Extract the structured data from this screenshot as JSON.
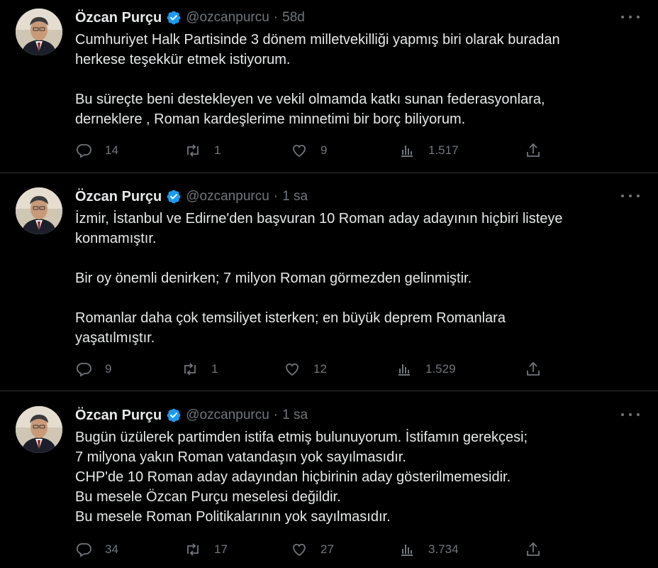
{
  "tweets": [
    {
      "author": {
        "name": "Özcan Purçu",
        "handle": "@ozcanpurcu"
      },
      "time": "58d",
      "paragraphs": [
        [
          "Cumhuriyet Halk Partisinde 3 dönem milletvekilliği yapmış biri olarak buradan",
          "herkese teşekkür etmek istiyorum."
        ],
        [
          "Bu süreçte beni destekleyen ve vekil olmamda katkı sunan federasyonlara,",
          "derneklere , Roman kardeşlerime minnetimi bir borç biliyorum."
        ]
      ],
      "stats": {
        "replies": "14",
        "retweets": "1",
        "likes": "9",
        "views": "1.517"
      }
    },
    {
      "author": {
        "name": "Özcan Purçu",
        "handle": "@ozcanpurcu"
      },
      "time": "1 sa",
      "paragraphs": [
        [
          "İzmir, İstanbul ve Edirne'den başvuran  10 Roman aday adayının hiçbiri listeye",
          "konmamıştır."
        ],
        [
          "Bir oy önemli denirken; 7 milyon Roman görmezden gelinmiştir."
        ],
        [
          "Romanlar daha çok temsiliyet isterken; en büyük deprem Romanlara",
          "yaşatılmıştır."
        ]
      ],
      "stats": {
        "replies": "9",
        "retweets": "1",
        "likes": "12",
        "views": "1.529"
      }
    },
    {
      "author": {
        "name": "Özcan Purçu",
        "handle": "@ozcanpurcu"
      },
      "time": "1 sa",
      "paragraphs": [
        [
          "Bugün üzülerek partimden istifa etmiş bulunuyorum. İstifamın gerekçesi;",
          "7 milyona yakın Roman vatandaşın yok sayılmasıdır.",
          "CHP'de 10 Roman aday adayından hiçbirinin aday gösterilmemesidir.",
          "Bu mesele Özcan Purçu meselesi değildir.",
          "Bu mesele Roman Politikalarının yok sayılmasıdır."
        ]
      ],
      "stats": {
        "replies": "34",
        "retweets": "17",
        "likes": "27",
        "views": "3.734"
      }
    }
  ],
  "colors": {
    "background": "#000000",
    "text": "#e7e9ea",
    "muted": "#71767b",
    "verified": "#1d9bf0",
    "divider": "#2f3336"
  },
  "icons": [
    "verified-badge-icon",
    "more-icon",
    "reply-icon",
    "retweet-icon",
    "like-icon",
    "views-icon",
    "share-icon"
  ]
}
